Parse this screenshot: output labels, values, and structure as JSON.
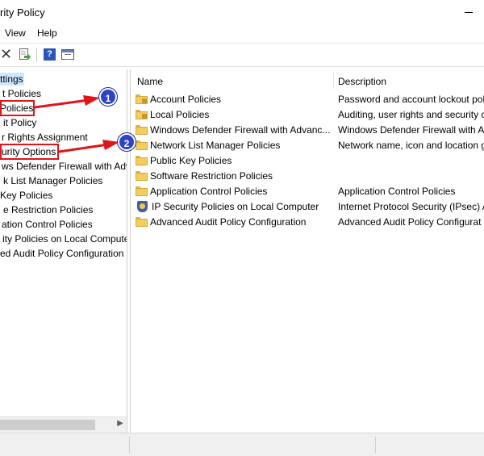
{
  "window": {
    "title": "rity Policy"
  },
  "menu": {
    "view": "View",
    "help": "Help"
  },
  "toolbar": {
    "delete_icon": "delete-icon",
    "export_icon": "export-list-icon",
    "help_icon": "help-icon",
    "view_icon": "show-hide-tree-icon",
    "help_glyph": "?"
  },
  "tree": {
    "items": [
      {
        "label": "ttings"
      },
      {
        "label": "t Policies"
      },
      {
        "label": "Policies"
      },
      {
        "label": "it Policy"
      },
      {
        "label": "r Rights Assignment"
      },
      {
        "label": "urity Options"
      },
      {
        "label": "ws Defender Firewall with Adva"
      },
      {
        "label": "k List Manager Policies"
      },
      {
        "label": "Key Policies"
      },
      {
        "label": "e Restriction Policies"
      },
      {
        "label": "ation Control Policies"
      },
      {
        "label": "ity Policies on Local Compute"
      },
      {
        "label": "ed Audit Policy Configuration"
      }
    ]
  },
  "list": {
    "columns": {
      "name": "Name",
      "description": "Description"
    },
    "rows": [
      {
        "name": "Account Policies",
        "description": "Password and account lockout pol",
        "icon": "locked-folder-icon"
      },
      {
        "name": "Local Policies",
        "description": "Auditing, user rights and security c",
        "icon": "locked-folder-icon"
      },
      {
        "name": "Windows Defender Firewall with Advanc...",
        "description": "Windows Defender Firewall with A",
        "icon": "folder-icon"
      },
      {
        "name": "Network List Manager Policies",
        "description": "Network name, icon and location g",
        "icon": "folder-icon"
      },
      {
        "name": "Public Key Policies",
        "description": "",
        "icon": "folder-icon"
      },
      {
        "name": "Software Restriction Policies",
        "description": "",
        "icon": "folder-icon"
      },
      {
        "name": "Application Control Policies",
        "description": "Application Control Policies",
        "icon": "folder-icon"
      },
      {
        "name": "IP Security Policies on Local Computer",
        "description": "Internet Protocol Security (IPsec) A",
        "icon": "shield-icon"
      },
      {
        "name": "Advanced Audit Policy Configuration",
        "description": "Advanced Audit Policy Configurat",
        "icon": "folder-icon"
      }
    ]
  },
  "annotations": {
    "badge1": "1",
    "badge2": "2",
    "color": "#e0141b",
    "badge_color": "#2d44c7"
  }
}
